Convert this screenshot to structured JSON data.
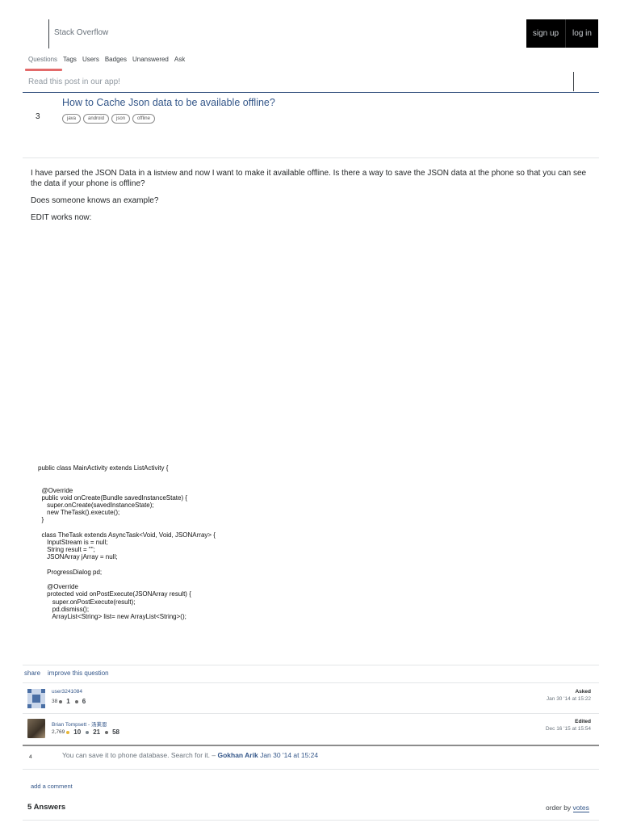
{
  "header": {
    "brand": "Stack Overflow",
    "signup_label": "sign up",
    "login_label": "log in"
  },
  "nav": {
    "items": [
      "Questions",
      "Tags",
      "Users",
      "Badges",
      "Unanswered",
      "Ask"
    ]
  },
  "app_banner": {
    "text": "Read this post in our app!"
  },
  "question": {
    "votes": "3",
    "title": "How to Cache Json data to be available offline?",
    "tags": [
      "java",
      "android",
      "json",
      "offline"
    ],
    "body": {
      "p1_before": "I have parsed the JSON Data in a ",
      "p1_code": "listview",
      "p1_after": " and now I want to make it available offline. Is there a way to save the JSON data at the phone so that you can see the data if your phone is offline?",
      "p2": "Does someone knows an example?",
      "p3": "EDIT works now:"
    },
    "code": "public class MainActivity extends ListActivity {\n\n\n  @Override\n  public void onCreate(Bundle savedInstanceState) {\n     super.onCreate(savedInstanceState);\n     new TheTask().execute();\n  }\n\n  class TheTask extends AsyncTask<Void, Void, JSONArray> {\n     InputStream is = null;\n     String result = \"\";\n     JSONArray jArray = null;\n\n     ProgressDialog pd;\n\n     @Override\n     protected void onPostExecute(JSONArray result) {\n        super.onPostExecute(result);\n        pd.dismiss();\n        ArrayList<String> list= new ArrayList<String>();",
    "actions": {
      "share": "share",
      "improve": "improve this question"
    }
  },
  "asker": {
    "name": "user3241084",
    "rep": "38",
    "silver": "1",
    "bronze": "6",
    "label": "Asked",
    "date": "Jan 30 '14 at 15:22"
  },
  "editor": {
    "name": "Brian Tompsett - 汤莱恩",
    "rep": "2,769",
    "gold": "10",
    "silver": "21",
    "bronze": "58",
    "label": "Edited",
    "date": "Dec 16 '15 at 15:54"
  },
  "comment": {
    "score": "4",
    "text": "You can save it to phone database. Search for it. – ",
    "user": "Gokhan Arik",
    "date": " Jan 30 '14 at 15:24"
  },
  "footer": {
    "add_comment": "add a comment",
    "answers_count": "5 Answers",
    "order_prefix": "order by ",
    "order_value": "votes"
  },
  "colors": {
    "link": "#335689",
    "nav_underline": "#e36a6a",
    "top_rule": "#3f5b86"
  }
}
